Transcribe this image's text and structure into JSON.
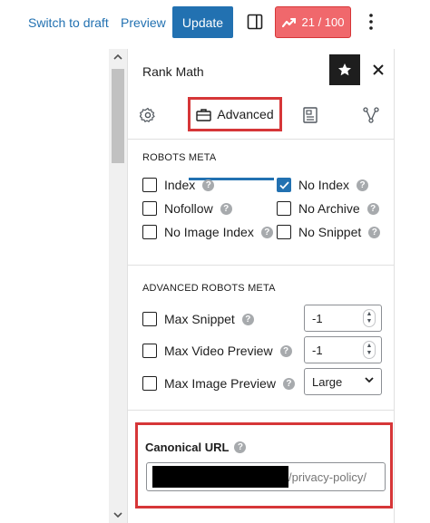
{
  "toolbar": {
    "switch_to_draft": "Switch to draft",
    "preview": "Preview",
    "update": "Update",
    "score": "21 / 100",
    "score_color": "#f0686c"
  },
  "panel": {
    "title": "Rank Math",
    "tabs": [
      {
        "icon": "gear-icon"
      },
      {
        "label": "Advanced",
        "icon": "briefcase-icon",
        "active": true
      },
      {
        "icon": "document-icon"
      },
      {
        "icon": "schema-icon"
      }
    ]
  },
  "robots_meta": {
    "heading": "ROBOTS META",
    "options": [
      {
        "label": "Index",
        "checked": false
      },
      {
        "label": "No Index",
        "checked": true
      },
      {
        "label": "Nofollow",
        "checked": false
      },
      {
        "label": "No Archive",
        "checked": false
      },
      {
        "label": "No Image Index",
        "checked": false
      },
      {
        "label": "No Snippet",
        "checked": false
      }
    ]
  },
  "advanced_robots_meta": {
    "heading": "ADVANCED ROBOTS META",
    "max_snippet": {
      "label": "Max Snippet",
      "value": "-1"
    },
    "max_video_preview": {
      "label": "Max Video Preview",
      "value": "-1"
    },
    "max_image_preview": {
      "label": "Max Image Preview",
      "value": "Large"
    }
  },
  "canonical": {
    "label": "Canonical URL",
    "value_visible": "/privacy-policy/"
  },
  "colors": {
    "accent": "#2271b1",
    "highlight": "#d63638"
  }
}
